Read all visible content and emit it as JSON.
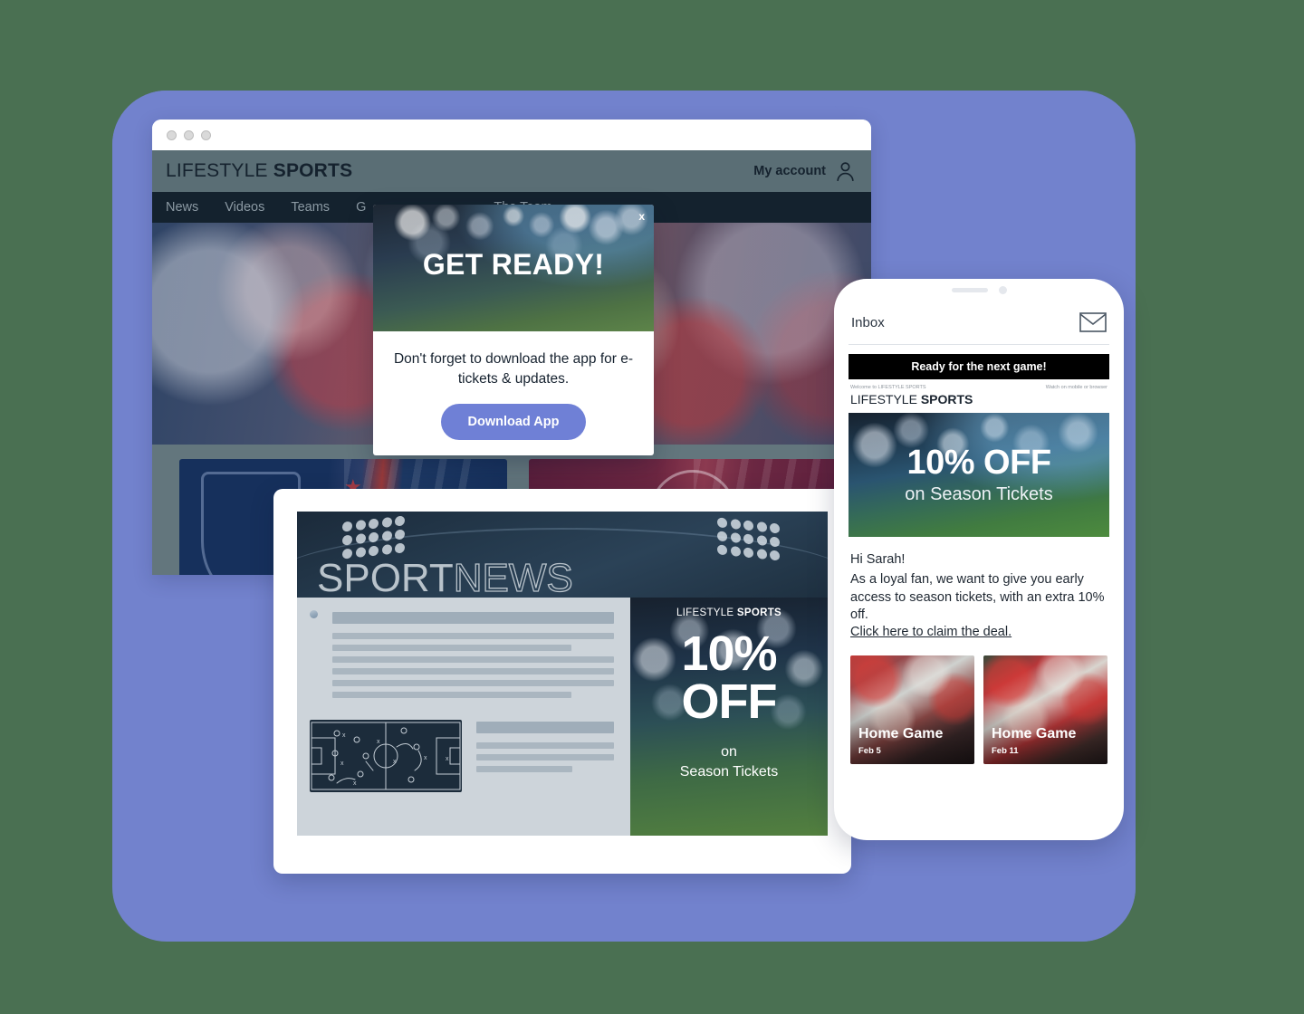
{
  "browser": {
    "site": {
      "brand_light": "LIFESTYLE",
      "brand_bold": "SPORTS",
      "account_label": "My account",
      "account_icon": "person-icon",
      "nav": [
        {
          "label": "News"
        },
        {
          "label": "Videos"
        },
        {
          "label": "Teams"
        },
        {
          "label": "G"
        },
        {
          "label": "The Team"
        }
      ]
    },
    "popup": {
      "close_label": "x",
      "title": "GET READY!",
      "message": "Don't forget to download the app for e-tickets & updates.",
      "button_label": "Download App",
      "button_color": "#6f80d6"
    }
  },
  "sportnews": {
    "logo_first": "SPORT",
    "logo_second": "NEWS",
    "ad": {
      "brand_light": "LIFESTYLE",
      "brand_bold": "SPORTS",
      "headline_line1": "10%",
      "headline_line2": "OFF",
      "sub_on": "on",
      "sub_tickets": "Season Tickets"
    }
  },
  "phone": {
    "inbox_label": "Inbox",
    "mail_icon": "envelope-icon",
    "email": {
      "banner": "Ready for the next game!",
      "preheader_left": "Welcome to LIFESTYLE SPORTS",
      "preheader_right": "Watch on mobile or browser",
      "brand_light": "LIFESTYLE",
      "brand_bold": "SPORTS",
      "hero_big": "10% OFF",
      "hero_sub": "on Season Tickets",
      "greeting": "Hi Sarah!",
      "body": "As a loyal fan, we want to give you early access to season tickets, with an extra 10% off.",
      "cta": "Click here to claim the deal.",
      "games": [
        {
          "title": "Home Game",
          "date": "Feb 5"
        },
        {
          "title": "Home Game",
          "date": "Feb 11"
        }
      ]
    }
  },
  "theme": {
    "page_background": "#4a7052",
    "device_frame": "#7282cd",
    "site_header": "#5a6e75",
    "site_nav": "#14222e"
  }
}
